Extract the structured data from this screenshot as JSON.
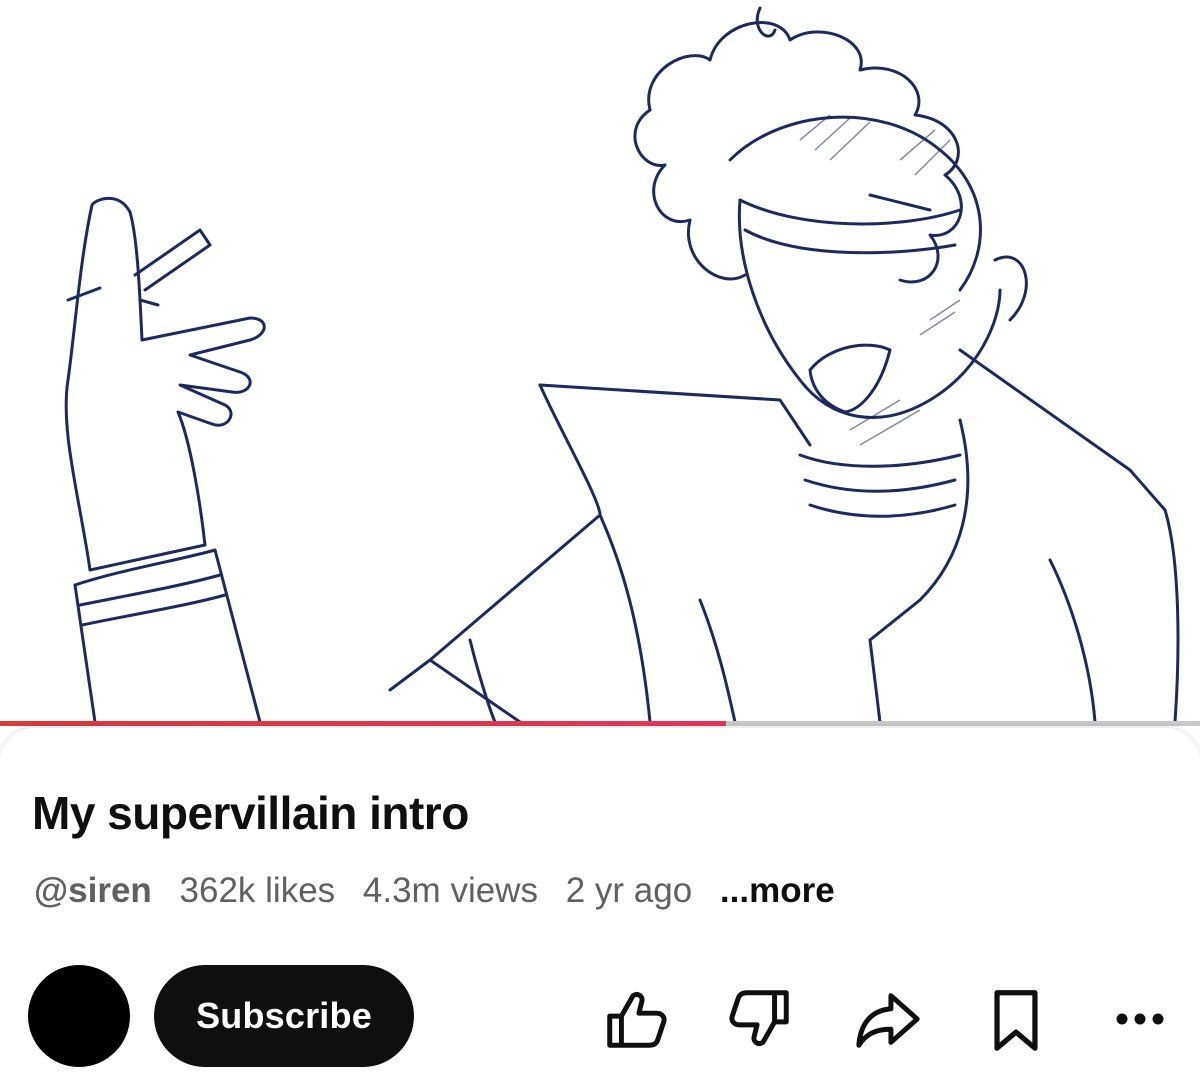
{
  "video": {
    "title": "My supervillain intro",
    "progress_fraction": 0.605
  },
  "meta": {
    "handle": "@siren",
    "likes": "362k likes",
    "views": "4.3m views",
    "age": "2 yr ago",
    "more": "...more"
  },
  "channel": {
    "subscribe_label": "Subscribe"
  },
  "actions": {
    "icons": [
      "thumbs-up-icon",
      "thumbs-down-icon",
      "share-icon",
      "bookmark-icon",
      "more-options-icon"
    ]
  },
  "colors": {
    "progress": "#e8345f",
    "sketch_ink": "#1f2a5c"
  }
}
